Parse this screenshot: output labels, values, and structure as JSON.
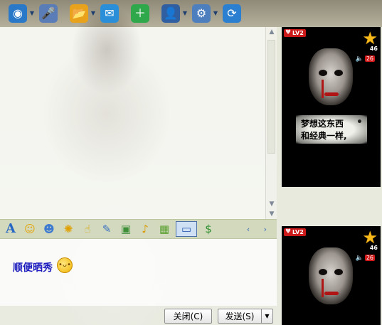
{
  "toolbar": {
    "buttons": [
      {
        "icon": "webcam-icon",
        "glyph": "◉",
        "color": "#2a78c8",
        "dropdown": true
      },
      {
        "icon": "microphone-icon",
        "glyph": "🎤",
        "color": "#5a7db8",
        "dropdown": false
      },
      {
        "icon": "send-file-icon",
        "glyph": "📂",
        "color": "#e9a21b",
        "dropdown": true
      },
      {
        "icon": "message-mail-icon",
        "glyph": "✉",
        "color": "#2a8fd8",
        "dropdown": false
      },
      {
        "icon": "add-app-icon",
        "glyph": "＋",
        "color": "#2ea84a",
        "dropdown": false
      },
      {
        "icon": "contact-card-icon",
        "glyph": "👤",
        "color": "#2f5fa0",
        "dropdown": true
      },
      {
        "icon": "settings-icon",
        "glyph": "⚙",
        "color": "#4d7fbf",
        "dropdown": true
      },
      {
        "icon": "browser-icon",
        "glyph": "⟳",
        "color": "#2a7fd0",
        "dropdown": false
      }
    ]
  },
  "format_bar": {
    "buttons": [
      {
        "icon": "font-icon",
        "glyph": "A"
      },
      {
        "icon": "emoticon-icon",
        "glyph": "☺"
      },
      {
        "icon": "magic-face-icon",
        "glyph": "☻"
      },
      {
        "icon": "nudge-icon",
        "glyph": "✺"
      },
      {
        "icon": "hand-icon",
        "glyph": "☝"
      },
      {
        "icon": "scribble-icon",
        "glyph": "✎"
      },
      {
        "icon": "image-icon",
        "glyph": "▣"
      },
      {
        "icon": "music-icon",
        "glyph": "♪"
      },
      {
        "icon": "gift-icon",
        "glyph": "▦"
      },
      {
        "icon": "screenshot-icon",
        "glyph": "▭"
      },
      {
        "icon": "pay-icon",
        "glyph": "$"
      }
    ],
    "nav": "‹ ›"
  },
  "input": {
    "text": "顺便晒秀",
    "emoji_icon": "thinking-emoji-icon"
  },
  "buttons": {
    "close": "关闭(C)",
    "send": "发送(S)",
    "send_dropdown": "▼"
  },
  "show_panels": [
    {
      "level": "LV2",
      "star_count": "46",
      "volume_count": "26",
      "caption": [
        "梦想这东西",
        "和经典一样,"
      ]
    },
    {
      "level": "LV2",
      "star_count": "46",
      "volume_count": "26"
    }
  ],
  "colors": {
    "input_text": "#1d1dbf",
    "accent": "#3a68b6",
    "level_badge": "#cc1a1a",
    "star": "#f7b81a"
  }
}
